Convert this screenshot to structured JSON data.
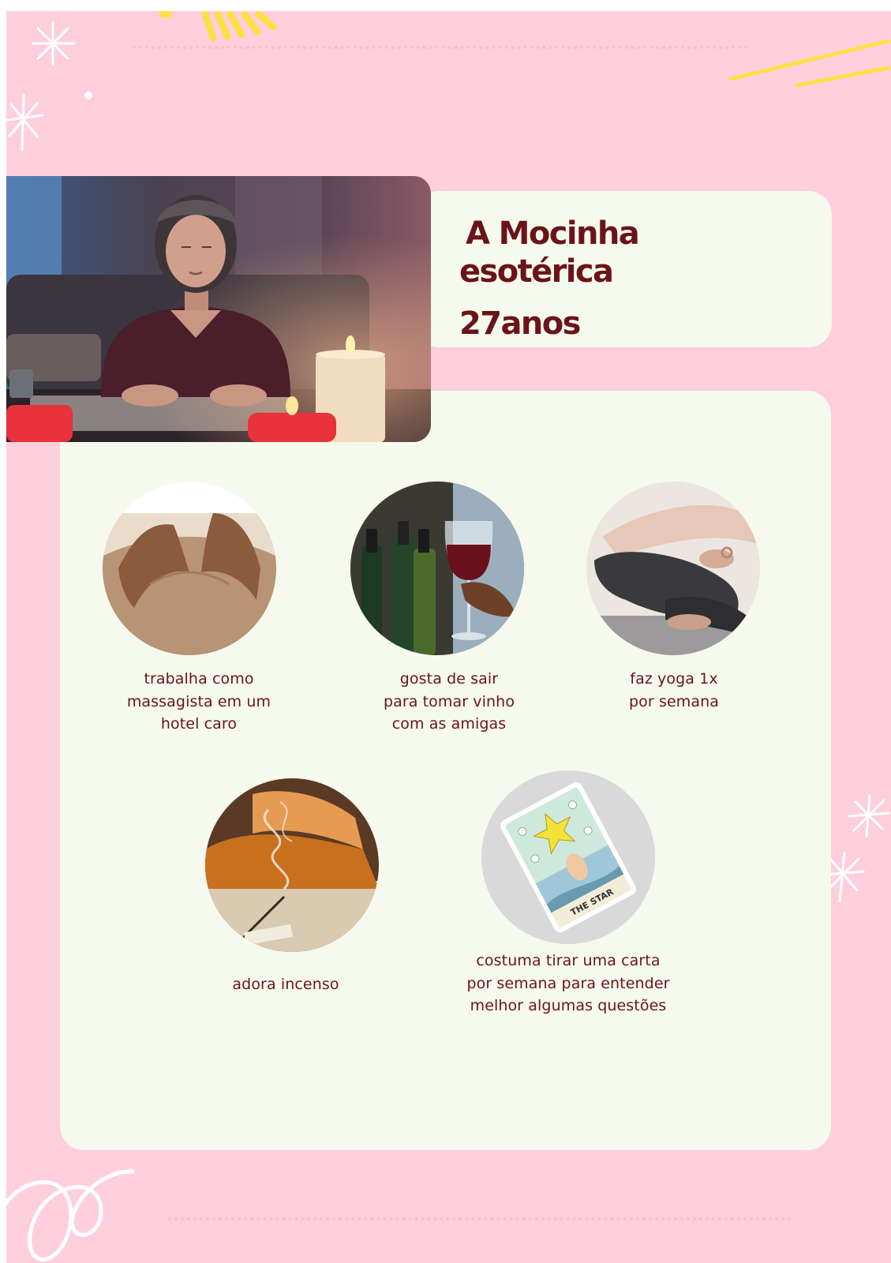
{
  "title": {
    "line1": "A Mocinha",
    "line2": "esotérica",
    "age": "27anos"
  },
  "hero_photo": {
    "description": "woman meditating at a table with candles"
  },
  "traits": [
    {
      "photo": "massage",
      "lines": [
        "trabalha como",
        "massagista em um",
        "hotel caro"
      ]
    },
    {
      "photo": "wine",
      "lines": [
        "gosta de sair",
        "para tomar vinho",
        "com as amigas"
      ]
    },
    {
      "photo": "yoga",
      "lines": [
        "faz yoga 1x",
        "por semana"
      ]
    },
    {
      "photo": "incense",
      "lines": [
        "adora incenso"
      ]
    },
    {
      "photo": "tarot-card",
      "lines": [
        "costuma tirar uma carta",
        "por semana para entender",
        "melhor algumas questões"
      ]
    }
  ],
  "tarot_card": {
    "label": "THE STAR"
  },
  "colors": {
    "background": "#fdcfdc",
    "card": "#f6f9ee",
    "text": "#6a1419",
    "accent_yellow": "#fde047"
  }
}
